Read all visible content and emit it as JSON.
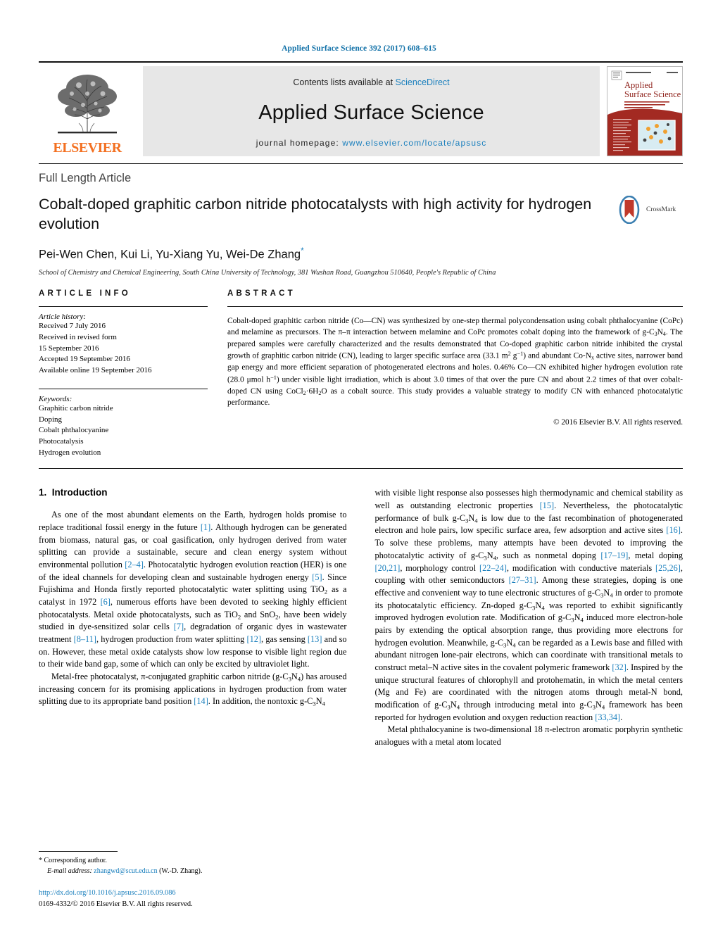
{
  "running_head": "Applied Surface Science 392 (2017) 608–615",
  "masthead": {
    "contents_prefix": "Contents lists available at ",
    "contents_link": "ScienceDirect",
    "journal_name": "Applied Surface Science",
    "homepage_prefix": "journal homepage: ",
    "homepage_url": "www.elsevier.com/locate/apsusc",
    "publisher": "ELSEVIER",
    "cover_title_line1": "Applied",
    "cover_title_line2": "Surface Science"
  },
  "title_block": {
    "article_type": "Full Length Article",
    "title": "Cobalt-doped graphitic carbon nitride photocatalysts with high activity for hydrogen evolution",
    "authors": "Pei-Wen Chen, Kui Li, Yu-Xiang Yu, Wei-De Zhang",
    "corresponding_marker": "*",
    "affiliation": "School of Chemistry and Chemical Engineering, South China University of Technology, 381 Wushan Road, Guangzhou 510640, People's Republic of China",
    "crossmark_label": "CrossMark"
  },
  "article_info": {
    "heading": "ARTICLE INFO",
    "history_label": "Article history:",
    "history": [
      "Received 7 July 2016",
      "Received in revised form",
      "15 September 2016",
      "Accepted 19 September 2016",
      "Available online 19 September 2016"
    ],
    "keywords_label": "Keywords:",
    "keywords": [
      "Graphitic carbon nitride",
      "Doping",
      "Cobalt phthalocyanine",
      "Photocatalysis",
      "Hydrogen evolution"
    ]
  },
  "abstract": {
    "heading": "ABSTRACT",
    "copyright": "© 2016 Elsevier B.V. All rights reserved."
  },
  "introduction": {
    "section_number": "1.",
    "section_title": "Introduction"
  },
  "footnote": {
    "corresponding": "* Corresponding author.",
    "email_label": "E-mail address:",
    "email": "zhangwd@scut.edu.cn",
    "email_suffix": "(W.-D. Zhang).",
    "doi": "http://dx.doi.org/10.1016/j.apsusc.2016.09.086",
    "issn_line": "0169-4332/© 2016 Elsevier B.V. All rights reserved."
  },
  "colors": {
    "link": "#1a7fbd",
    "running_head": "#1171a8",
    "elsevier_orange": "#f37021",
    "masthead_bg": "#e7e7e7",
    "cover_red": "#a32a22"
  }
}
